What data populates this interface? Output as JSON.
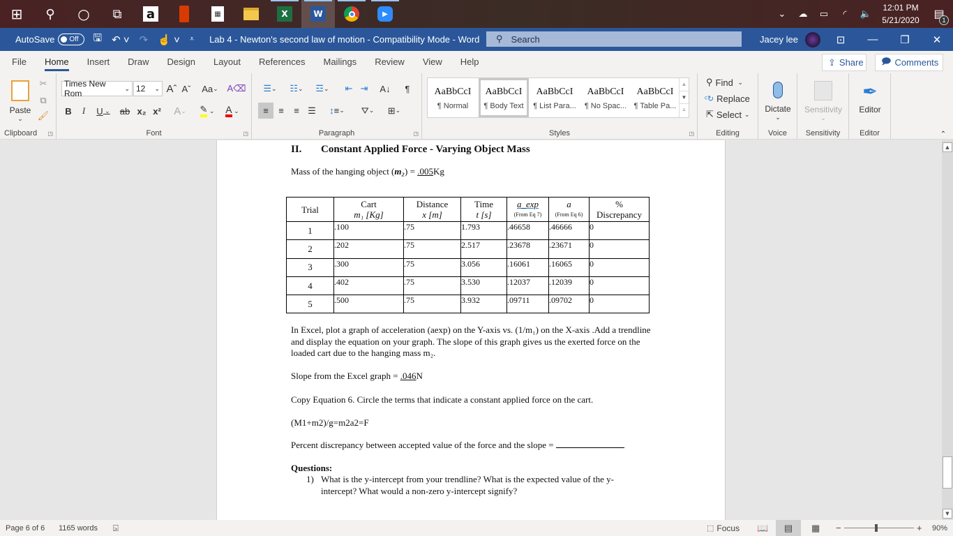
{
  "taskbar": {
    "apps": [
      {
        "name": "start",
        "glyph": "⊞"
      },
      {
        "name": "search",
        "glyph": "⚲"
      },
      {
        "name": "cortana",
        "glyph": "○"
      },
      {
        "name": "task-view",
        "glyph": "⧉"
      },
      {
        "name": "amazon",
        "glyph": "a"
      },
      {
        "name": "office",
        "glyph": "▮"
      },
      {
        "name": "calculator",
        "glyph": "▦"
      },
      {
        "name": "file-explorer",
        "glyph": "▭"
      },
      {
        "name": "excel",
        "glyph": "X"
      },
      {
        "name": "word",
        "glyph": "W"
      },
      {
        "name": "chrome",
        "glyph": "◉"
      },
      {
        "name": "zoom",
        "glyph": "▶"
      }
    ],
    "tray": {
      "time": "12:01 PM",
      "date": "5/21/2020",
      "notification_count": "1"
    }
  },
  "titlebar": {
    "autosave_label": "AutoSave",
    "autosave_state": "Off",
    "document_title": "Lab 4 - Newton's second law of motion  -  Compatibility Mode  -  Word",
    "search_placeholder": "Search",
    "user_name": "Jacey lee"
  },
  "tabs": [
    "File",
    "Home",
    "Insert",
    "Draw",
    "Design",
    "Layout",
    "References",
    "Mailings",
    "Review",
    "View",
    "Help"
  ],
  "active_tab": "Home",
  "share_label": "Share",
  "comments_label": "Comments",
  "ribbon": {
    "clipboard": {
      "label": "Clipboard",
      "paste": "Paste"
    },
    "font": {
      "label": "Font",
      "font_name": "Times New Rom",
      "font_size": "12",
      "change_case": "Aa",
      "bold": "B",
      "italic": "I",
      "underline": "U",
      "strike": "ab",
      "subscript": "x₂",
      "superscript": "x²"
    },
    "paragraph": {
      "label": "Paragraph"
    },
    "styles": {
      "label": "Styles",
      "items": [
        {
          "sample": "AaBbCcI",
          "name": "¶ Normal"
        },
        {
          "sample": "AaBbCcI",
          "name": "¶ Body Text"
        },
        {
          "sample": "AaBbCcI",
          "name": "¶ List Para..."
        },
        {
          "sample": "AaBbCcI",
          "name": "¶ No Spac..."
        },
        {
          "sample": "AaBbCcI",
          "name": "¶ Table Pa..."
        }
      ],
      "selected": "¶ Body Text"
    },
    "editing": {
      "label": "Editing",
      "find": "Find",
      "replace": "Replace",
      "select": "Select"
    },
    "voice": {
      "label": "Voice",
      "dictate": "Dictate"
    },
    "sensitivity": {
      "label": "Sensitivity",
      "button": "Sensitivity"
    },
    "editor": {
      "label": "Editor",
      "button": "Editor"
    }
  },
  "document": {
    "section_number": "II.",
    "section_title": "Constant Applied Force - Varying Object Mass",
    "mass_prefix": "Mass of the hanging object (",
    "mass_var": "m₂",
    "mass_mid": ") = ",
    "mass_value": ".005",
    "mass_unit": "Kg",
    "table": {
      "headers": [
        {
          "line1": "Trial",
          "line2": ""
        },
        {
          "line1": "Cart",
          "line2": "m₁ [Kg]"
        },
        {
          "line1": "Distance",
          "line2": "x [m]"
        },
        {
          "line1": "Time",
          "line2": "t [s]"
        },
        {
          "line1": "a_exp",
          "line2": "(From Eq 7)"
        },
        {
          "line1": "a",
          "line2": "(From Eq 6)"
        },
        {
          "line1": "%",
          "line2": "Discrepancy"
        }
      ],
      "rows": [
        [
          "1",
          ".100",
          ".75",
          "1.793",
          ".46658",
          ".46666",
          "0"
        ],
        [
          "2",
          ".202",
          ".75",
          "2.517",
          ".23678",
          ".23671",
          "0"
        ],
        [
          "3",
          ".300",
          ".75",
          "3.056",
          ".16061",
          ".16065",
          "0"
        ],
        [
          "4",
          ".402",
          ".75",
          "3.530",
          ".12037",
          ".12039",
          "0"
        ],
        [
          "5",
          ".500",
          ".75",
          "3.932",
          ".09711",
          ".09702",
          "0"
        ]
      ]
    },
    "instruction": "In Excel, plot a graph of acceleration (aexp) on the Y-axis vs. (1/m₁) on the X-axis .Add a trendline and display the equation on your graph. The slope of this graph gives us the exerted force on the loaded cart due to the hanging mass m₂.",
    "slope_label": "Slope from the Excel graph = ",
    "slope_value": ".046",
    "slope_unit": "N",
    "copy_eq": "Copy Equation 6. Circle the terms that indicate a constant applied force on the cart.",
    "equation": "(M1+m2)/g=m2a2=F",
    "percent_label": "Percent discrepancy between accepted value of the force and the slope = ",
    "percent_value": "",
    "questions_label": "Questions:",
    "questions": [
      {
        "num": "1)",
        "text": "What is the y-intercept from your trendline? What is the expected value of the y-intercept? What would a non-zero y-intercept signify?"
      }
    ]
  },
  "statusbar": {
    "page": "Page 6 of 6",
    "words": "1165 words",
    "focus": "Focus",
    "zoom": "90%"
  }
}
